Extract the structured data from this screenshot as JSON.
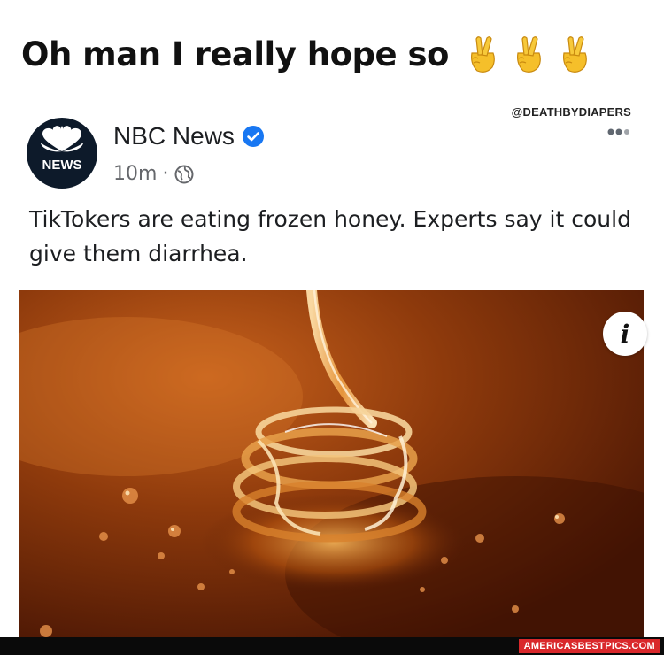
{
  "caption": {
    "text": "Oh man I really hope so",
    "emoji": [
      "crossed-fingers-icon",
      "crossed-fingers-icon",
      "crossed-fingers-icon"
    ]
  },
  "watermark_top": "@DEATHBYDIAPERS",
  "post": {
    "avatar_label": "NEWS",
    "page_name": "NBC News",
    "time": "10m",
    "separator": "·",
    "privacy_icon": "globe-icon",
    "more_icon": "more-options-icon",
    "headline": "TikTokers are eating frozen honey. Experts say it could give them diarrhea.",
    "info_label": "i"
  },
  "watermark_bottom": "AMERICASBESTPICS.COM",
  "colors": {
    "verified": "#1877f2",
    "avatar_bg": "#0d1a2a",
    "honey_dark": "#5a1e06",
    "honey_light": "#c8621c",
    "watermark_red": "#d9282b"
  }
}
